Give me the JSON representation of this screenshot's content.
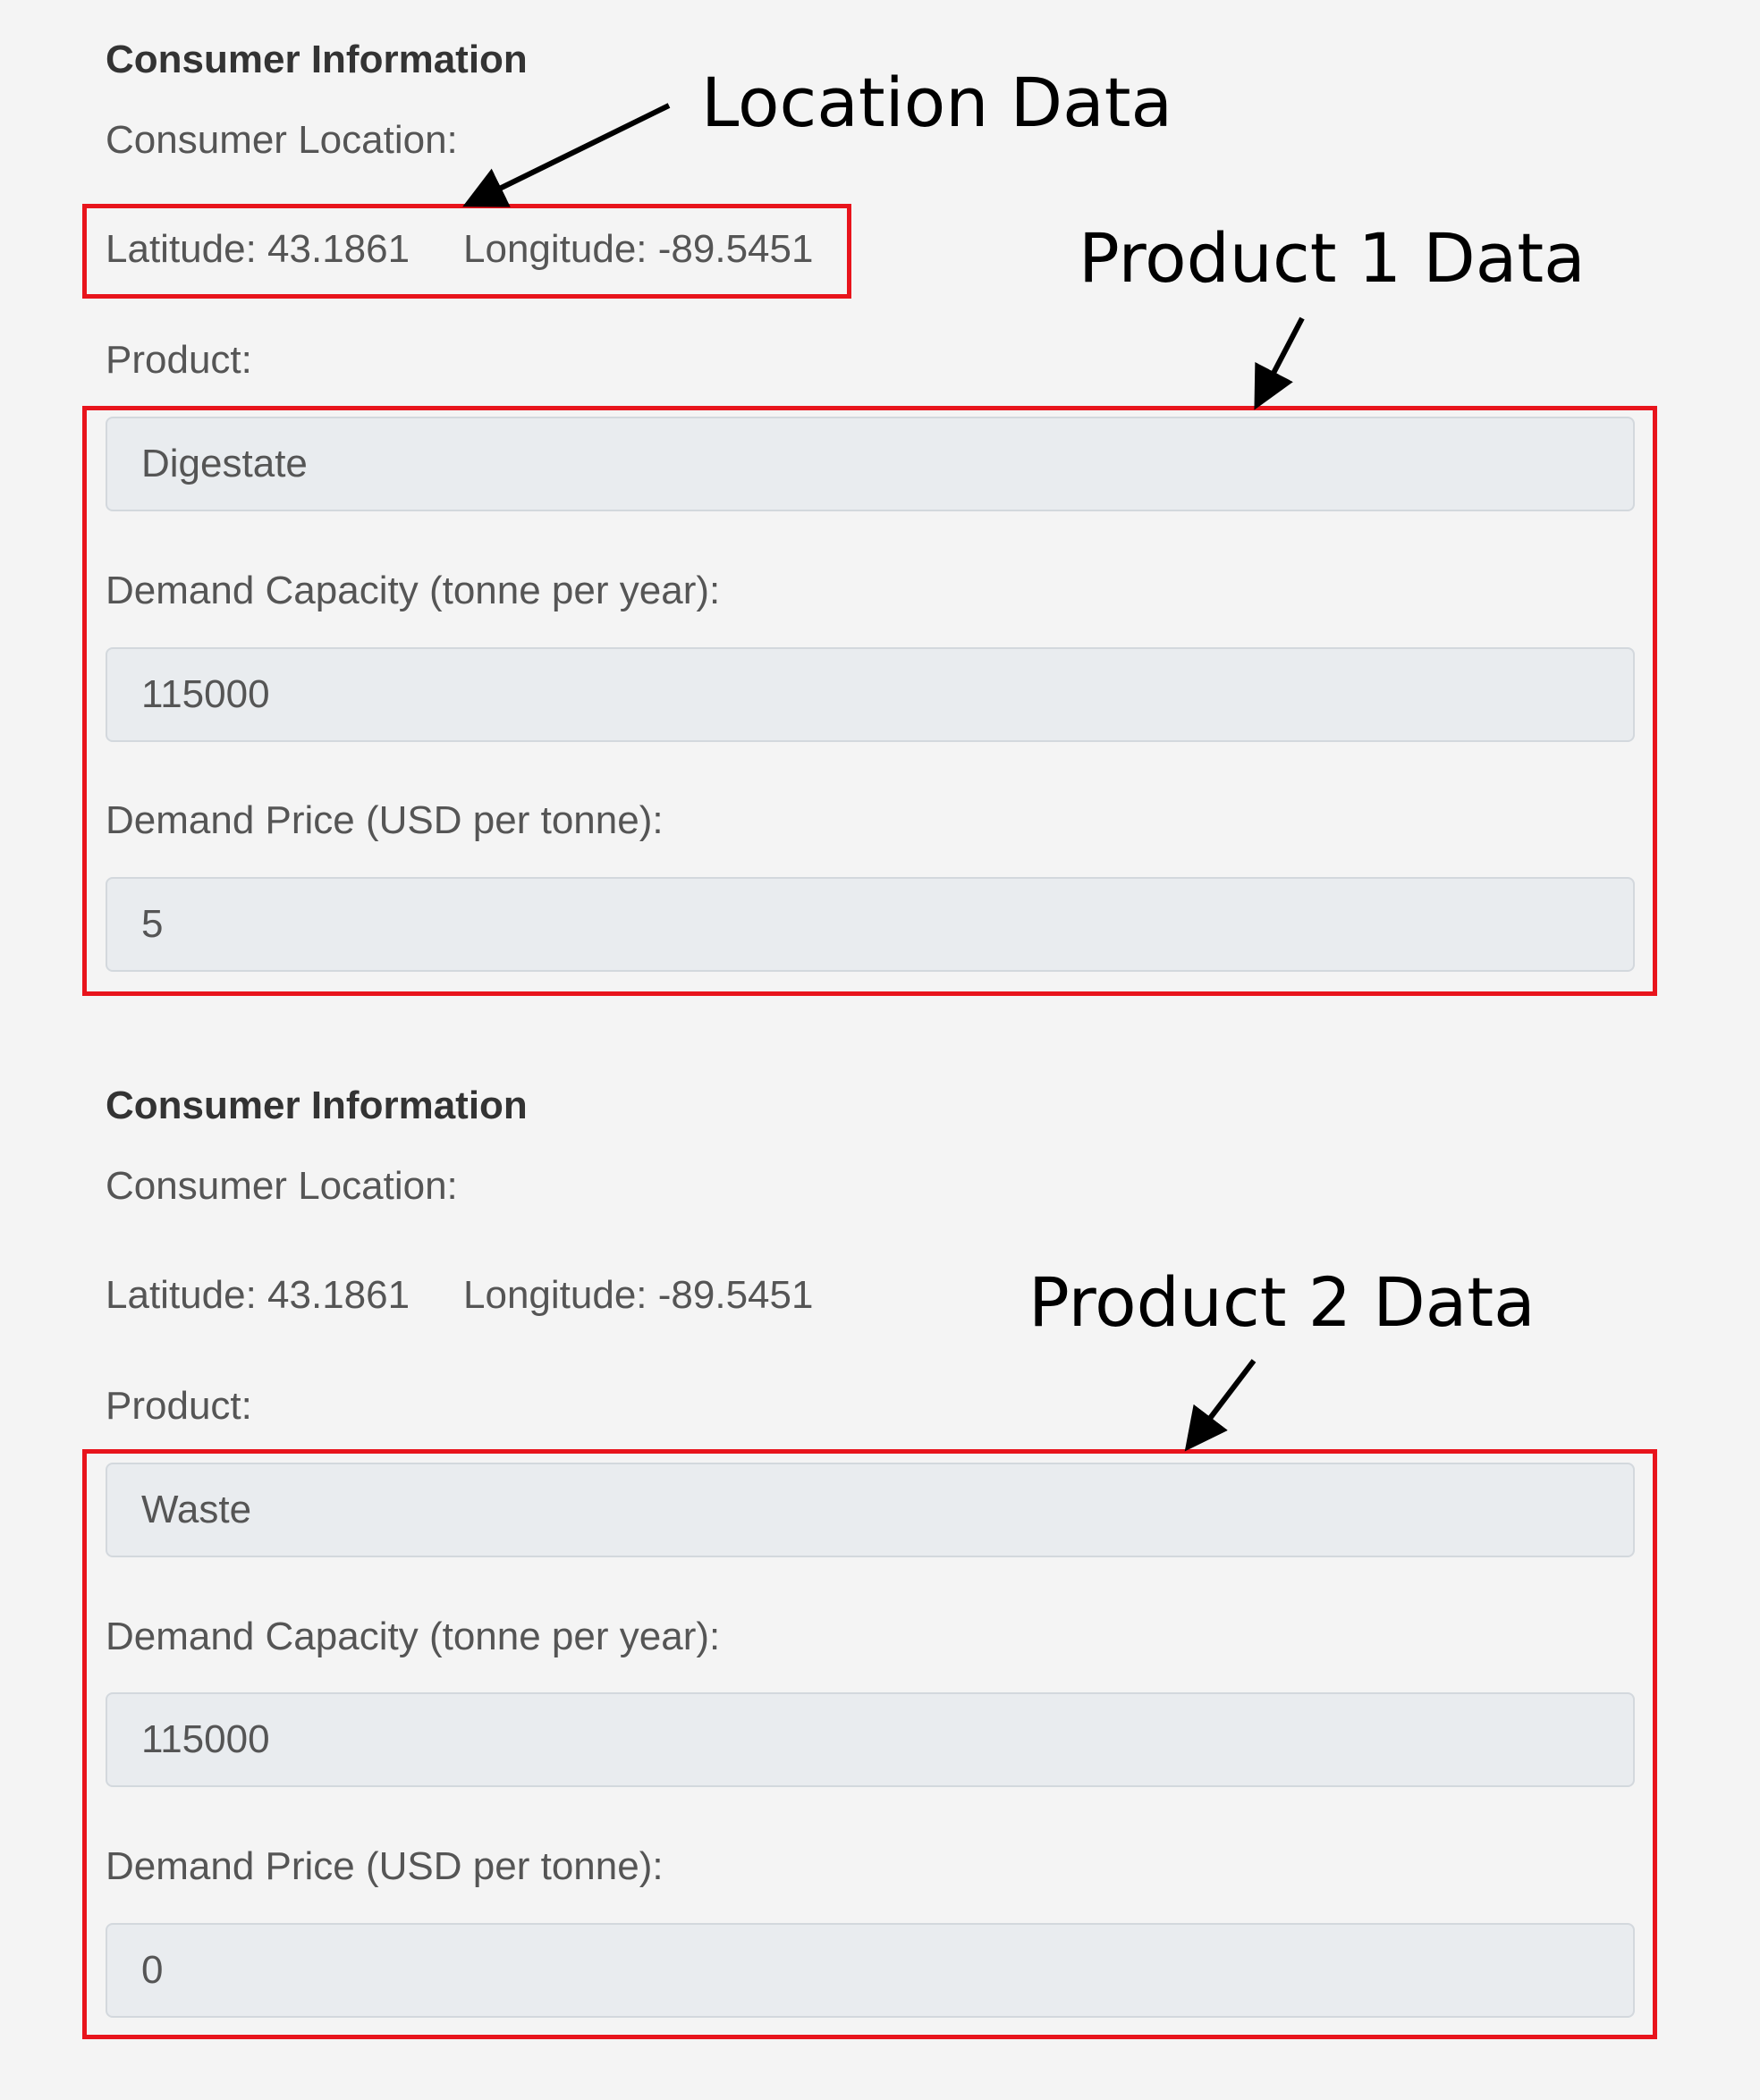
{
  "sections": [
    {
      "heading": "Consumer Information",
      "location_label": "Consumer Location:",
      "latitude_text": "Latitude: 43.1861",
      "longitude_text": "Longitude: -89.5451",
      "product_label": "Product:",
      "product_value": "Digestate",
      "capacity_label": "Demand Capacity (tonne per year):",
      "capacity_value": "115000",
      "price_label": "Demand Price (USD per tonne):",
      "price_value": "5"
    },
    {
      "heading": "Consumer Information",
      "location_label": "Consumer Location:",
      "latitude_text": "Latitude: 43.1861",
      "longitude_text": "Longitude: -89.5451",
      "product_label": "Product:",
      "product_value": "Waste",
      "capacity_label": "Demand Capacity (tonne per year):",
      "capacity_value": "115000",
      "price_label": "Demand Price (USD per tonne):",
      "price_value": "0"
    }
  ],
  "annotations": {
    "location": "Location Data",
    "product1": "Product 1 Data",
    "product2": "Product 2 Data",
    "highlight_color": "#e8141c"
  }
}
